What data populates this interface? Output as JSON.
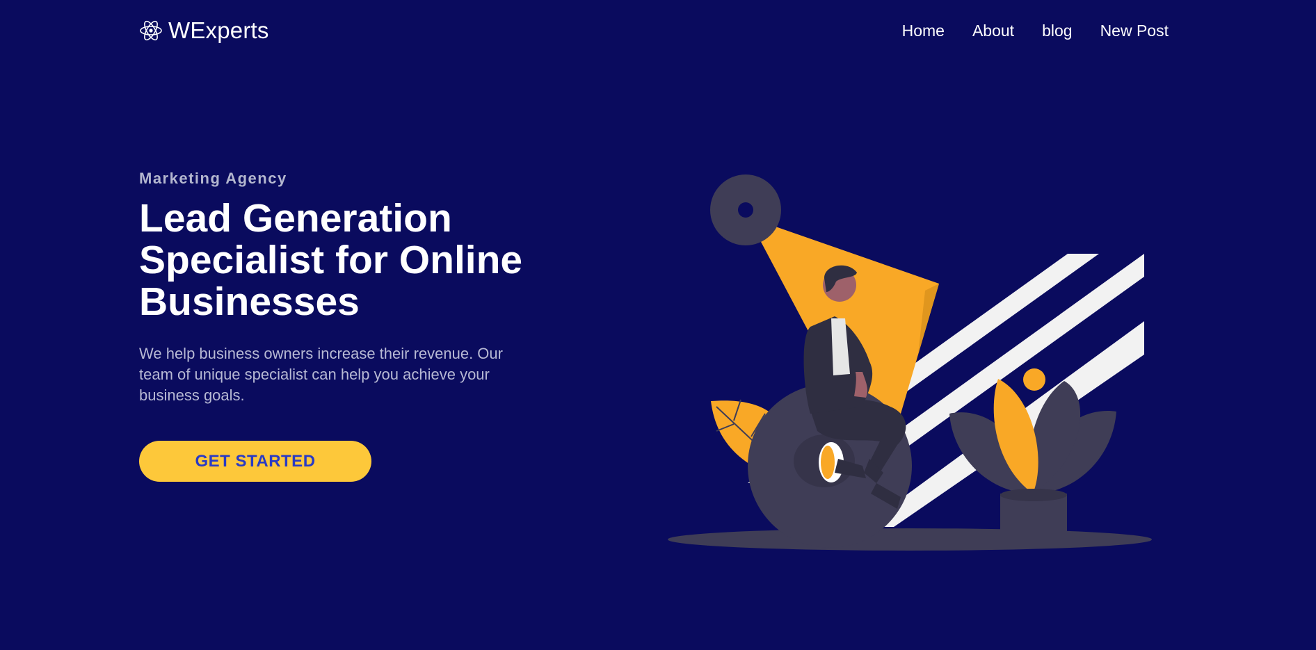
{
  "brand": {
    "name": "WExperts",
    "icon": "atom-icon"
  },
  "nav": {
    "items": [
      {
        "label": "Home"
      },
      {
        "label": "About"
      },
      {
        "label": "blog"
      },
      {
        "label": "New Post"
      }
    ]
  },
  "hero": {
    "eyebrow": "Marketing Agency",
    "headline": "Lead Generation Specialist for Online Businesses",
    "description": "We help business owners increase their revenue. Our team of unique specialist can help you achieve your business goals.",
    "cta_label": "GET STARTED"
  },
  "colors": {
    "background": "#0a0b5e",
    "accent": "#fdc83a",
    "cta_text": "#2a3bc4",
    "illustration_gray": "#3f3d56",
    "illustration_orange": "#f9a826"
  }
}
